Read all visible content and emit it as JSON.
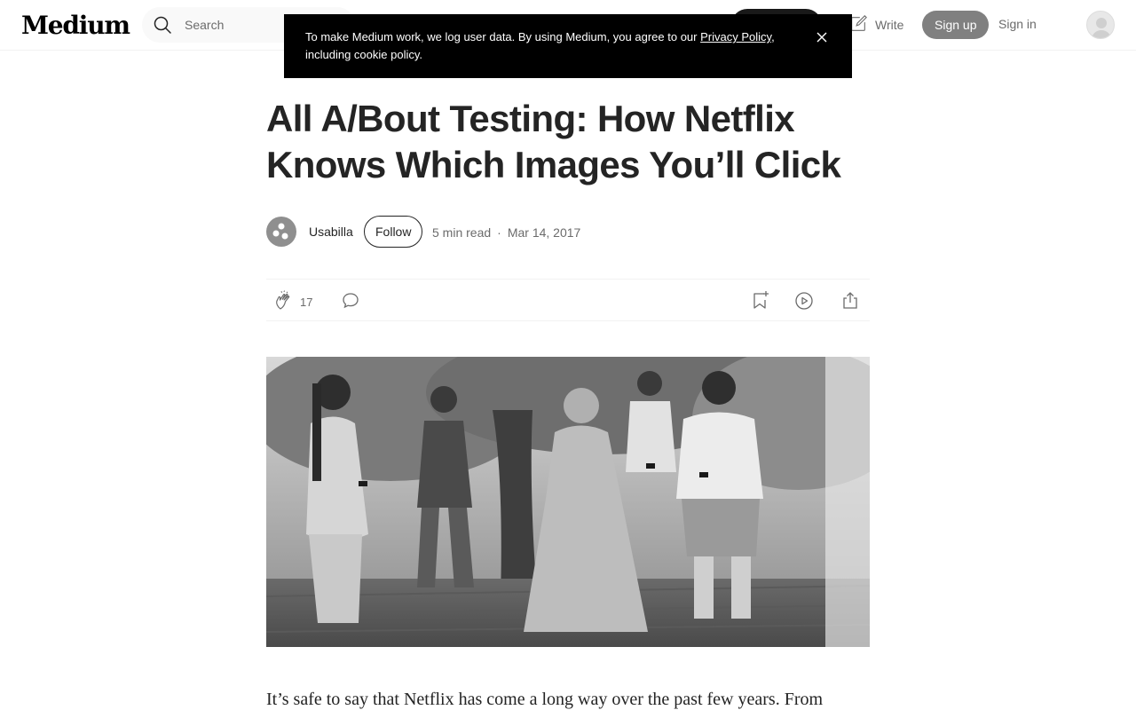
{
  "header": {
    "logo": "Medium",
    "search_placeholder": "Search",
    "write_label": "Write",
    "signup_label": "Sign up",
    "signin_label": "Sign in"
  },
  "cookie_banner": {
    "text_before": "To make Medium work, we log user data. By using Medium, you agree to our ",
    "link_text": "Privacy Policy",
    "text_after": ", including cookie policy."
  },
  "article": {
    "title": "All A/Bout Testing: How Netflix Knows Which Images You’ll Click",
    "author": "Usabilla",
    "follow_label": "Follow",
    "read_time": "5 min read",
    "date": "Mar 14, 2017",
    "clap_count": "17",
    "first_paragraph": "It’s safe to say that Netflix has come a long way over the past few years. From"
  },
  "colors": {
    "text": "#242424",
    "muted": "#6b6b6b",
    "banner": "#000000",
    "signup": "#808080"
  },
  "icons": [
    "search-icon",
    "write-icon",
    "close-icon",
    "clap-icon",
    "comment-icon",
    "bookmark-add-icon",
    "play-icon",
    "share-icon"
  ]
}
